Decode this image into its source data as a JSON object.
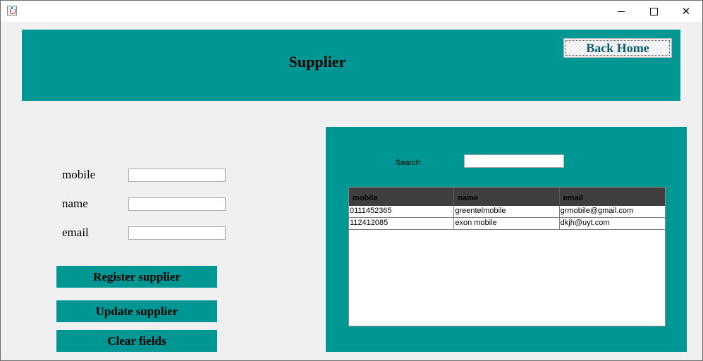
{
  "window": {
    "controls": {
      "minimize_icon": "minimize-icon",
      "maximize_icon": "maximize-icon",
      "close_icon": "close-icon",
      "close_glyph": "✕"
    }
  },
  "header": {
    "title": "Supplier",
    "back_button": "Back Home"
  },
  "form": {
    "fields": [
      {
        "label": "mobile",
        "value": ""
      },
      {
        "label": "name",
        "value": ""
      },
      {
        "label": "email",
        "value": ""
      }
    ],
    "buttons": {
      "register": "Register supplier",
      "update": "Update supplier",
      "clear": "Clear fields"
    }
  },
  "panel": {
    "search_label": "Search",
    "search_value": "",
    "table": {
      "columns": [
        "mobile",
        "name",
        "email"
      ],
      "rows": [
        [
          "0111452365",
          "greentelmobile",
          "grmobile@gmail.com"
        ],
        [
          "112412085",
          "exon mobile",
          "dkjh@uyt.com"
        ]
      ]
    }
  },
  "colors": {
    "accent": "#009694",
    "table_header": "#3f3f3f",
    "back_text": "#0c5c6e"
  }
}
